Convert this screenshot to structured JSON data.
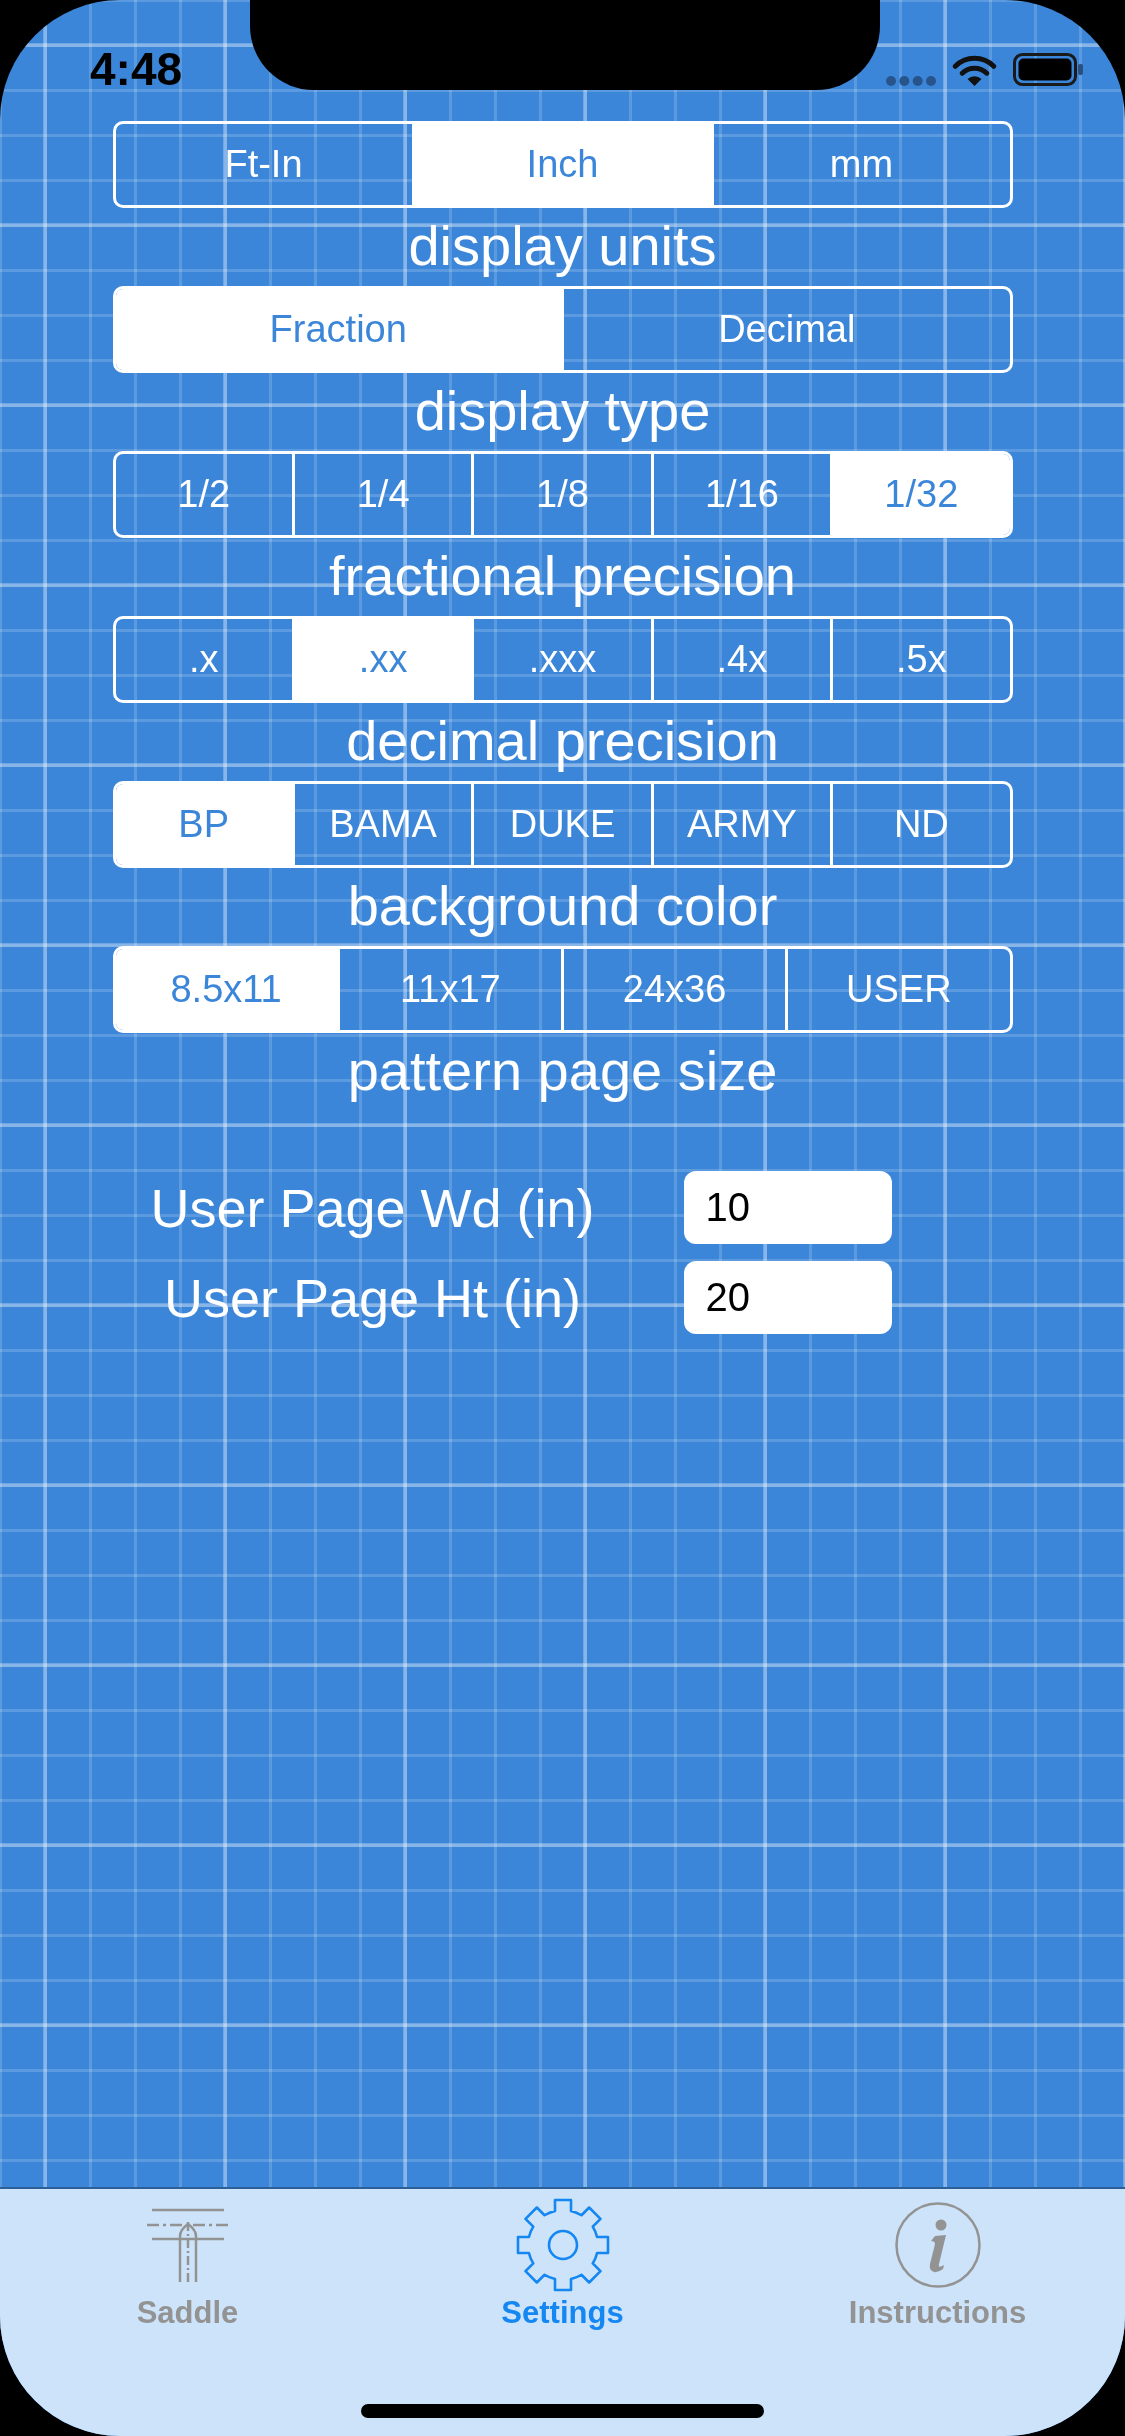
{
  "status_bar": {
    "time": "4:48"
  },
  "settings": [
    {
      "label": "display units",
      "options": [
        {
          "label": "Ft-In",
          "selected": false
        },
        {
          "label": "Inch",
          "selected": true
        },
        {
          "label": "mm",
          "selected": false
        }
      ]
    },
    {
      "label": "display type",
      "options": [
        {
          "label": "Fraction",
          "selected": true
        },
        {
          "label": "Decimal",
          "selected": false
        }
      ]
    },
    {
      "label": "fractional precision",
      "options": [
        {
          "label": "1/2",
          "selected": false
        },
        {
          "label": "1/4",
          "selected": false
        },
        {
          "label": "1/8",
          "selected": false
        },
        {
          "label": "1/16",
          "selected": false
        },
        {
          "label": "1/32",
          "selected": true
        }
      ]
    },
    {
      "label": "decimal precision",
      "options": [
        {
          "label": ".x",
          "selected": false
        },
        {
          "label": ".xx",
          "selected": true
        },
        {
          "label": ".xxx",
          "selected": false
        },
        {
          "label": ".4x",
          "selected": false
        },
        {
          "label": ".5x",
          "selected": false
        }
      ]
    },
    {
      "label": "background color",
      "options": [
        {
          "label": "BP",
          "selected": true
        },
        {
          "label": "BAMA",
          "selected": false
        },
        {
          "label": "DUKE",
          "selected": false
        },
        {
          "label": "ARMY",
          "selected": false
        },
        {
          "label": "ND",
          "selected": false
        }
      ]
    },
    {
      "label": "pattern page size",
      "options": [
        {
          "label": "8.5x11",
          "selected": true
        },
        {
          "label": "11x17",
          "selected": false
        },
        {
          "label": "24x36",
          "selected": false
        },
        {
          "label": "USER",
          "selected": false
        }
      ]
    }
  ],
  "user_page": [
    {
      "label": "User Page Wd (in)",
      "value": "10"
    },
    {
      "label": "User Page Ht (in)",
      "value": "20"
    }
  ],
  "tab_bar": [
    {
      "label": "Saddle",
      "selected": false
    },
    {
      "label": "Settings",
      "selected": true
    },
    {
      "label": "Instructions",
      "selected": false
    }
  ]
}
